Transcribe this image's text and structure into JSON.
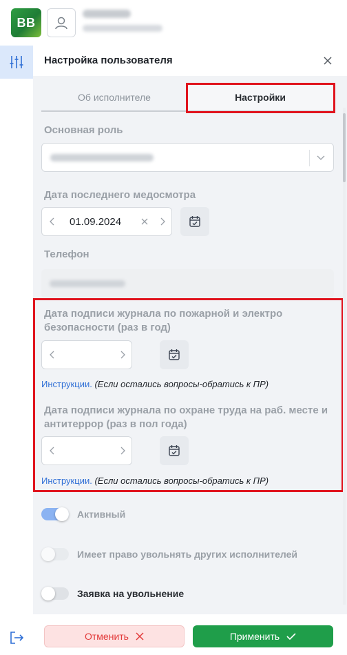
{
  "header": {
    "logo_text": "BB",
    "user_name": "Елена Д.",
    "user_role": "Помощник руководителя"
  },
  "rail": {
    "settings_icon": "sliders-icon",
    "logout_icon": "logout-icon"
  },
  "panel": {
    "title": "Настройка пользователя",
    "tabs": [
      {
        "label": "Об исполнителе",
        "active": false
      },
      {
        "label": "Настройки",
        "active": true
      }
    ],
    "role": {
      "label": "Основная роль",
      "value": "Помощник руководителя"
    },
    "medical": {
      "label": "Дата последнего медосмотра",
      "value": "01.09.2024"
    },
    "phone": {
      "label": "Телефон",
      "value": "+79010000000"
    },
    "fire_safety": {
      "label": "Дата подписи журнала по пожарной и электро безопасности (раз в год)",
      "value": "",
      "link": "Инструкции.",
      "note": "(Если остались вопросы-обратись к ПР)"
    },
    "labor_safety": {
      "label": "Дата подписи журнала по охране труда на раб. месте и антитеррор (раз в пол года)",
      "value": "",
      "link": "Инструкции.",
      "note": "(Если остались вопросы-обратись к ПР)"
    },
    "toggles": [
      {
        "label": "Активный",
        "on": true,
        "disabled": true
      },
      {
        "label": "Имеет право увольнять других исполнителей",
        "on": false,
        "disabled": true
      },
      {
        "label": "Заявка на увольнение",
        "on": false,
        "disabled": false
      }
    ]
  },
  "footer": {
    "cancel_label": "Отменить",
    "apply_label": "Применить"
  },
  "colors": {
    "accent": "#2f6fd6",
    "highlight": "#e0141e",
    "apply": "#1f9e4a",
    "cancel_bg": "#fde2e2",
    "cancel_text": "#e23b3b"
  }
}
